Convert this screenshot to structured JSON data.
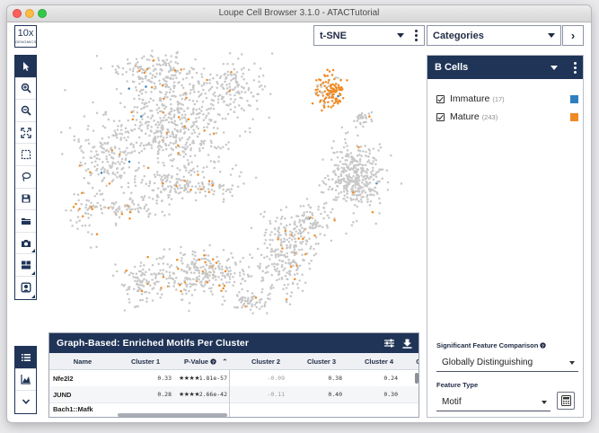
{
  "window": {
    "title": "Loupe Cell Browser 3.1.0 - ATACTutorial"
  },
  "logo": {
    "big": "10x",
    "small": "GENOMICS"
  },
  "toolbar": {
    "tools": [
      "pointer-icon",
      "zoom-in-icon",
      "zoom-out-icon",
      "fit-icon",
      "select-rect-icon",
      "lasso-icon",
      "save-icon",
      "folder-icon",
      "camera-icon",
      "layout-icon",
      "image-icon"
    ],
    "bottom": [
      "list-icon",
      "chart-icon",
      "chevron-down-icon"
    ]
  },
  "projection": {
    "selected": "t-SNE"
  },
  "categories": {
    "selected": "Categories"
  },
  "right_panel": {
    "title": "B Cells",
    "clusters": [
      {
        "name": "Immature",
        "count": "(17)",
        "color": "#2f7fbf"
      },
      {
        "name": "Mature",
        "count": "(243)",
        "color": "#f08a24"
      }
    ],
    "sig_label": "Significant Feature Comparison",
    "sig_value": "Globally Distinguishing",
    "feature_type_label": "Feature Type",
    "feature_type_value": "Motif"
  },
  "table": {
    "title": "Graph-Based: Enriched Motifs Per Cluster",
    "columns": [
      "Name",
      "Cluster 1",
      "P-Value",
      "Cluster 2",
      "Cluster 3",
      "Cluster 4",
      "C"
    ],
    "rows": [
      {
        "name": "Nfe2l2",
        "c1": "0.33",
        "stars": "★★★★",
        "pval": "1.81e-57",
        "c2": "-0.09",
        "c3": "0.38",
        "c4": "0.24"
      },
      {
        "name": "JUND",
        "c1": "0.28",
        "stars": "★★★★",
        "pval": "2.66e-42",
        "c2": "-0.11",
        "c3": "0.40",
        "c4": "0.30"
      },
      {
        "name": "Bach1::Mafk",
        "c1": "",
        "stars": "",
        "pval": "",
        "c2": "",
        "c3": "",
        "c4": ""
      }
    ]
  },
  "colors": {
    "navy": "#1f3457",
    "dot_gray": "#c8c8c8",
    "immature": "#2f7fbf",
    "mature": "#f08a24"
  }
}
